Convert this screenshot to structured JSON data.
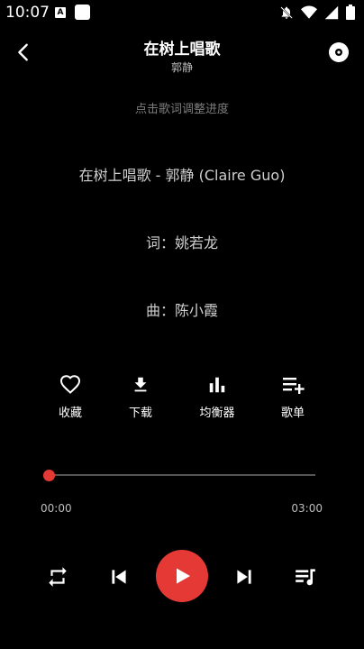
{
  "status_bar": {
    "time": "10:07",
    "notif_badge": "A"
  },
  "header": {
    "title": "在树上唱歌",
    "artist": "郭静"
  },
  "hint": "点击歌词调整进度",
  "lyrics": {
    "line1": "在树上唱歌 - 郭静 (Claire Guo)",
    "line2": "词：姚若龙",
    "line3": "曲：陈小霞"
  },
  "actions": {
    "favorite": "收藏",
    "download": "下载",
    "equalizer": "均衡器",
    "playlist": "歌单"
  },
  "player": {
    "current_time": "00:00",
    "total_time": "03:00",
    "progress": 0.0
  },
  "colors": {
    "accent": "#e53935",
    "background": "#000000"
  },
  "icons": {
    "back": "chevron-left-icon",
    "disc": "disc-icon",
    "favorite": "heart-icon",
    "download": "download-icon",
    "equalizer": "bar-chart-icon",
    "playlist": "playlist-add-icon",
    "repeat": "repeat-icon",
    "previous": "skip-previous-icon",
    "play": "play-icon",
    "next": "skip-next-icon",
    "queue": "queue-music-icon"
  }
}
